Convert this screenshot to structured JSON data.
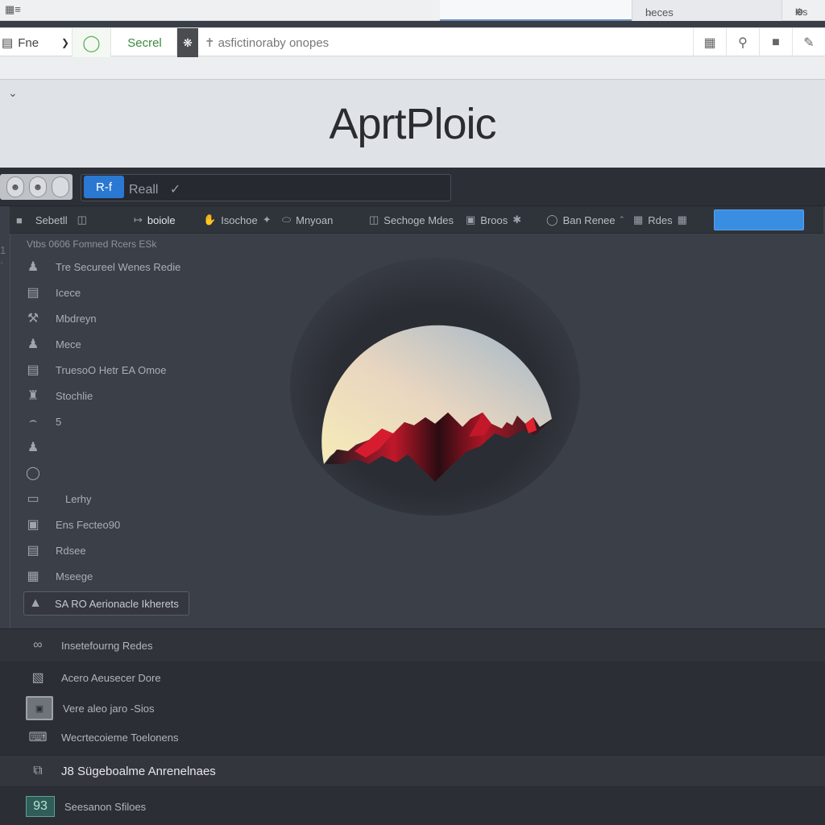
{
  "browser": {
    "tab_left_icon": "browser-window-icon",
    "tab_right_label": "heces",
    "tab_far_label": "les",
    "file_menu_label": "Fne",
    "secured_label": "Secrel",
    "url_text": "asfictinoraby onopes"
  },
  "header": {
    "title": "AprtPloic"
  },
  "app": {
    "search_chip_label": "R-f",
    "search_text": "Reall",
    "toolbar": [
      {
        "label": "Sebetll",
        "icon": "pointer-icon"
      },
      {
        "label": "boiole",
        "icon": "text-cursor-icon"
      },
      {
        "label": "Isochoe",
        "icon": "hand-icon"
      },
      {
        "label": "Mnyoan",
        "icon": "shape-icon"
      },
      {
        "label": "Sechoge Mdes",
        "icon": "frame-icon"
      },
      {
        "label": "Broos",
        "icon": "brush-icon"
      },
      {
        "label": "Ban Renee",
        "icon": "circle-icon"
      },
      {
        "label": "Rdes",
        "icon": "grid-icon"
      }
    ],
    "sidebar": {
      "heading": "Vtbs 0606 Fomned Rcers ESk",
      "items": [
        "Tre Secureel Wenes Redie",
        "Icece",
        "Mbdreyn",
        "Mece",
        "TruesoO Hetr EA Omoe",
        "Stochlie",
        "5",
        "",
        "",
        "Lerhy",
        "Ens Fecteo90",
        "Rdsee",
        "Mseege"
      ],
      "boxed_item": "SA RO Aerionacle Ikherets"
    },
    "bottom_rows": [
      "Insetefourng Redes",
      "Acero Aeusecer Dore",
      "Vere aleo jaro -Sios",
      "Wecrtecoieme Toelonens",
      "J8 Sügeboalme Anrenelnaes",
      "Seesanon Sfiloes"
    ],
    "badge_number": "93"
  }
}
